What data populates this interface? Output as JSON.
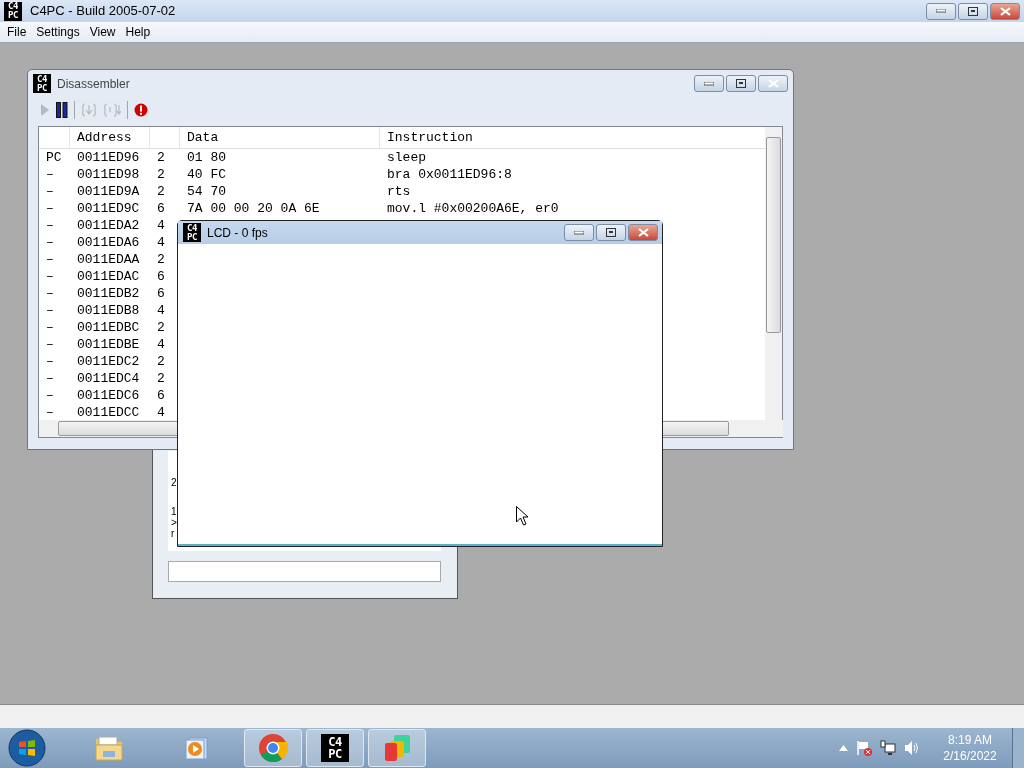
{
  "window": {
    "title": "C4PC - Build 2005-07-02",
    "icon": [
      "C4",
      "PC"
    ],
    "menu": [
      "File",
      "Settings",
      "View",
      "Help"
    ]
  },
  "disassembler": {
    "title": "Disassembler",
    "icon": [
      "C4",
      "PC"
    ],
    "toolbar": [
      {
        "kind": "run",
        "disabled": true
      },
      {
        "kind": "pause",
        "disabled": false
      },
      {
        "kind": "step-into",
        "disabled": true
      },
      {
        "kind": "step-over",
        "disabled": true
      },
      {
        "kind": "break",
        "disabled": false
      }
    ],
    "columns": [
      "Address",
      "Data",
      "Instruction"
    ],
    "rows": [
      {
        "marker": "PC",
        "address": "0011ED96",
        "length": "2",
        "data": "01 80",
        "instruction": "sleep"
      },
      {
        "marker": "–",
        "address": "0011ED98",
        "length": "2",
        "data": "40 FC",
        "instruction": "bra 0x0011ED96:8"
      },
      {
        "marker": "–",
        "address": "0011ED9A",
        "length": "2",
        "data": "54 70",
        "instruction": "rts"
      },
      {
        "marker": "–",
        "address": "0011ED9C",
        "length": "6",
        "data": "7A 00 00 20 0A 6E",
        "instruction": "mov.l #0x00200A6E, er0"
      },
      {
        "marker": "–",
        "address": "0011EDA2",
        "length": "4"
      },
      {
        "marker": "–",
        "address": "0011EDA6",
        "length": "4"
      },
      {
        "marker": "–",
        "address": "0011EDAA",
        "length": "2"
      },
      {
        "marker": "–",
        "address": "0011EDAC",
        "length": "6"
      },
      {
        "marker": "–",
        "address": "0011EDB2",
        "length": "6"
      },
      {
        "marker": "–",
        "address": "0011EDB8",
        "length": "4"
      },
      {
        "marker": "–",
        "address": "0011EDBC",
        "length": "2"
      },
      {
        "marker": "–",
        "address": "0011EDBE",
        "length": "4"
      },
      {
        "marker": "–",
        "address": "0011EDC2",
        "length": "2"
      },
      {
        "marker": "–",
        "address": "0011EDC4",
        "length": "2"
      },
      {
        "marker": "–",
        "address": "0011EDC6",
        "length": "6"
      },
      {
        "marker": "–",
        "address": "0011EDCC",
        "length": "4"
      }
    ]
  },
  "console": {
    "lines": [
      "2",
      "1",
      ">",
      "r"
    ]
  },
  "lcd": {
    "title": "LCD - 0 fps",
    "icon": [
      "C4",
      "PC"
    ]
  },
  "taskbar": {
    "apps": [
      {
        "kind": "folder",
        "open": false
      },
      {
        "kind": "media",
        "open": false
      },
      {
        "kind": "browser",
        "open": true
      },
      {
        "kind": "c4pc",
        "open": true,
        "icon": [
          "C4",
          "PC"
        ]
      },
      {
        "kind": "tiles",
        "open": true
      }
    ],
    "clock": {
      "time": "8:19 AM",
      "date": "2/16/2022"
    }
  }
}
